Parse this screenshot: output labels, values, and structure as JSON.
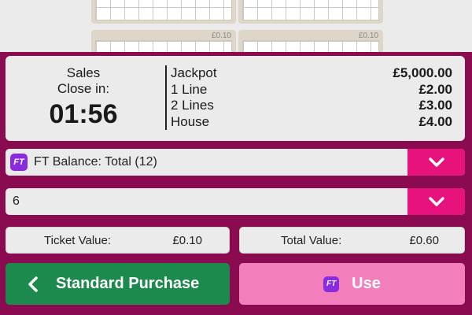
{
  "tickets": [
    {
      "price": ""
    },
    {
      "price": ""
    },
    {
      "price": "£0.10"
    },
    {
      "price": "£0.10"
    }
  ],
  "sales": {
    "label_line1": "Sales",
    "label_line2": "Close in:",
    "timer": "01:56"
  },
  "prizes": [
    {
      "name": "Jackpot",
      "amount": "£5,000.00"
    },
    {
      "name": "1 Line",
      "amount": "£2.00"
    },
    {
      "name": "2 Lines",
      "amount": "£3.00"
    },
    {
      "name": "House",
      "amount": "£4.00"
    }
  ],
  "balance_select": {
    "badge": "FT",
    "value": "FT Balance: Total (12)",
    "icon": "chevron-down-icon"
  },
  "quantity_select": {
    "value": "6",
    "icon": "chevron-down-icon"
  },
  "ticket_value": {
    "label": "Ticket Value:",
    "value": "£0.10"
  },
  "total_value": {
    "label": "Total Value:",
    "value": "£0.60"
  },
  "buttons": {
    "standard_purchase": "Standard Purchase",
    "use_badge": "FT",
    "use": "Use"
  },
  "colors": {
    "panel": "#8b0b50",
    "accent": "#e8127d",
    "standard_button": "#1c8a4c",
    "use_button": "#f27fbc",
    "ft_badge": "#8a2be2"
  }
}
